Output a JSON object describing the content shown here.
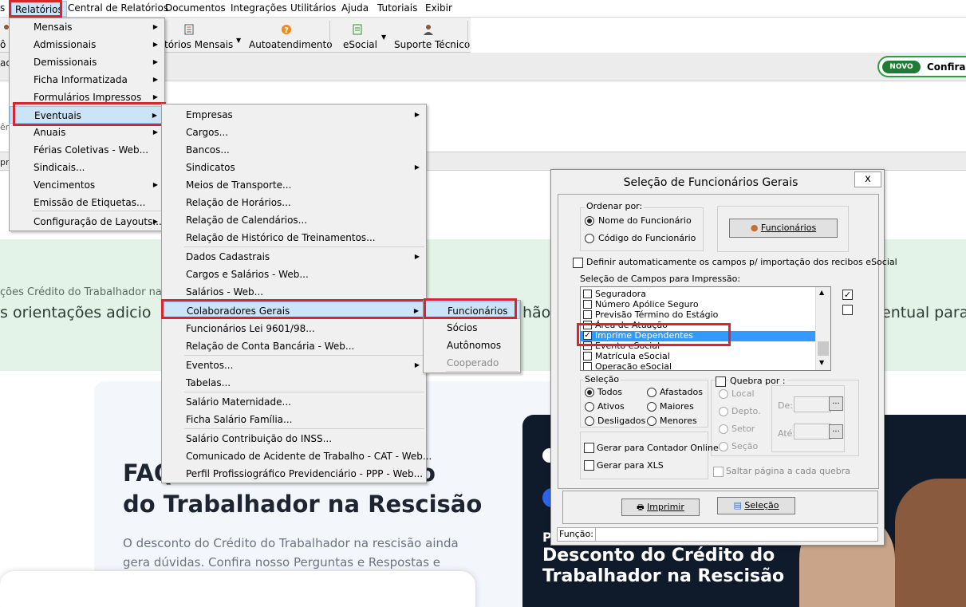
{
  "menubar": {
    "items": [
      "s",
      "Relatórios",
      "Central de Relatórios",
      "Documentos",
      "Integrações",
      "Utilitários",
      "Ajuda",
      "Tutoriais",
      "Exibir"
    ]
  },
  "toolbar": {
    "partial_left": "ô",
    "relatorios_mensais": "tórios Mensais",
    "autoatendimento": "Autoatendimento",
    "esocial": "eSocial",
    "suporte": "Suporte Técnico"
  },
  "side_fragments": [
    "ad",
    "ên",
    "pr"
  ],
  "novo": {
    "badge": "NOVO",
    "text": "Confira as"
  },
  "web": {
    "banner_small": "ções Crédito do Trabalhador na",
    "banner_big_left": "s orientações adicio",
    "banner_big_mid": "hão",
    "banner_big_right": "entual para",
    "faq_line1": "FAQ",
    "faq_line1_tail": "o",
    "faq_line2": "do Trabalhador na Rescisão",
    "desc_line1": "O desconto do Crédito do Trabalhador na rescisão ainda",
    "desc_line2": "gera dúvidas. Confira nosso Perguntas e Respostas e",
    "promo_p": "P",
    "promo_line1": "Desconto do Crédito do",
    "promo_line2": "Trabalhador  na Rescisão"
  },
  "menu_relatorios": [
    {
      "label": "Mensais",
      "submenu": true
    },
    {
      "label": "Admissionais",
      "submenu": true
    },
    {
      "label": "Demissionais",
      "submenu": true
    },
    {
      "label": "Ficha Informatizada",
      "submenu": true
    },
    {
      "label": "Formulários Impressos",
      "submenu": true
    },
    {
      "label": "Eventuais",
      "submenu": true,
      "highlighted": true
    },
    {
      "label": "Anuais",
      "submenu": true
    },
    {
      "label": "Férias Coletivas - Web...",
      "submenu": false
    },
    {
      "label": "Sindicais...",
      "submenu": false
    },
    {
      "label": "Vencimentos",
      "submenu": true
    },
    {
      "label": "Emissão de Etiquetas...",
      "submenu": false
    },
    {
      "label": "Configuração de Layouts...",
      "submenu": true
    }
  ],
  "menu_eventuais": [
    {
      "label": "Empresas",
      "submenu": true
    },
    {
      "label": "Cargos...",
      "submenu": false
    },
    {
      "label": "Bancos...",
      "submenu": false
    },
    {
      "label": "Sindicatos",
      "submenu": true
    },
    {
      "label": "Meios de Transporte...",
      "submenu": false
    },
    {
      "label": "Relação de Horários...",
      "submenu": false
    },
    {
      "label": "Relação de Calendários...",
      "submenu": false
    },
    {
      "label": "Relação de Histórico de Treinamentos...",
      "submenu": false
    },
    {
      "label": "Dados Cadastrais",
      "submenu": true
    },
    {
      "label": "Cargos e Salários - Web...",
      "submenu": false
    },
    {
      "label": "Salários - Web...",
      "submenu": false
    },
    {
      "label": "Colaboradores Gerais",
      "submenu": true,
      "highlighted": true
    },
    {
      "label": "Funcionários Lei 9601/98...",
      "submenu": false
    },
    {
      "label": "Relação de Conta Bancária - Web...",
      "submenu": false
    },
    {
      "label": "Eventos...",
      "submenu": true
    },
    {
      "label": "Tabelas...",
      "submenu": false
    },
    {
      "label": "Salário Maternidade...",
      "submenu": false
    },
    {
      "label": "Ficha Salário Família...",
      "submenu": false
    },
    {
      "label": "Salário Contribuição do INSS...",
      "submenu": false
    },
    {
      "label": "Comunicado de Acidente de Trabalho - CAT - Web...",
      "submenu": false
    },
    {
      "label": "Perfil Profissiográfico Previdenciário - PPP - Web...",
      "submenu": false
    }
  ],
  "menu_colaboradores": [
    {
      "label": "Funcionários",
      "highlighted": true,
      "disabled": false
    },
    {
      "label": "Sócios",
      "disabled": false
    },
    {
      "label": "Autônomos",
      "disabled": false
    },
    {
      "label": "Cooperado",
      "disabled": true
    }
  ],
  "dialog": {
    "title": "Seleção de Funcionários Gerais",
    "close": "x",
    "ordenar_label": "Ordenar por:",
    "ordenar_opts": [
      {
        "label": "Nome do Funcionário",
        "checked": true
      },
      {
        "label": "Código do Funcionário",
        "checked": false
      }
    ],
    "funcionarios_btn": "Funcionários",
    "auto_campos": "Definir automaticamente os campos p/ importação dos recibos eSocial",
    "campos_label": "Seleção de Campos para Impressão:",
    "campos": [
      {
        "label": "Seguradora",
        "checked": false
      },
      {
        "label": "Número Apólice Seguro",
        "checked": false
      },
      {
        "label": "Previsão Término do Estágio",
        "checked": false
      },
      {
        "label": "Área de Atuação",
        "checked": false
      },
      {
        "label": "Imprime Dependentes",
        "checked": true,
        "selected": true
      },
      {
        "label": "Evento eSocial",
        "checked": false
      },
      {
        "label": "Matrícula eSocial",
        "checked": false
      },
      {
        "label": "Operação eSocial",
        "checked": false
      }
    ],
    "side_checks": [
      true,
      false
    ],
    "selecao_label": "Seleção",
    "selecao_opts": [
      {
        "label": "Todos",
        "checked": true
      },
      {
        "label": "Afastados",
        "checked": false
      },
      {
        "label": "Ativos",
        "checked": false
      },
      {
        "label": "Maiores",
        "checked": false
      },
      {
        "label": "Desligados",
        "checked": false
      },
      {
        "label": "Menores",
        "checked": false
      }
    ],
    "quebra_label": "Quebra por :",
    "quebra_opts": [
      "Local",
      "Depto.",
      "Setor",
      "Seção"
    ],
    "de_label": "De:",
    "ate_label": "Até:",
    "ellipsis": "...",
    "contador": "Gerar para Contador Online",
    "xls": "Gerar para XLS",
    "saltar": "Saltar página a cada quebra",
    "imprimir": "Imprimir",
    "selecao_btn": "Seleção",
    "funcao_label": "Função:"
  },
  "colors": {
    "highlight_box": "#d9252f",
    "menu_hl": "#cce4f7",
    "list_sel": "#3399ff",
    "novo_green": "#1e7d32",
    "banner": "#e3f3e7"
  }
}
